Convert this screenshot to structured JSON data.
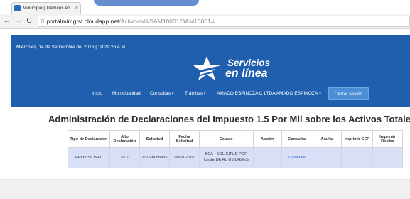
{
  "browser": {
    "tab_title": "Municipio | Trámites en L",
    "tab_close": "×",
    "url_host": "portalmimgtst.cloudapp.net",
    "url_path": "/ActivosMil/SAM10001/SAM10001#",
    "back": "←",
    "forward": "→",
    "reload": "C"
  },
  "header": {
    "datetime": "Miércoles, 14 de Septiembre del 2016 | 10:29:26 A.M.",
    "logo_line1": "Servicios",
    "logo_line2": "en línea",
    "nav": {
      "inicio": "Inicio",
      "municipalidad": "Municipalidad",
      "consultas": "Consultas",
      "tramites": "Trámites",
      "user": "AMADO ESPINOZA C LTDA AMADO ESPINOZA",
      "caret": "▾",
      "logout": "Cerrar sesión"
    }
  },
  "main": {
    "title": "Administración de Declaraciones del Impuesto 1.5 Por Mil sobre los Activos Totales",
    "columns": [
      "Tipo de Declaración",
      "Año Declaración",
      "Solicitud",
      "Fecha Solicitud",
      "Estado",
      "Acción",
      "Consultar",
      "Anular",
      "Imprimir CEP",
      "Imprimir Recibo"
    ],
    "rows": [
      {
        "tipo": "PROVISIONAL",
        "anio": "2011",
        "solicitud": "2016-0088955",
        "fecha": "09/08/2016",
        "estado": "SCA - SOLICITUD POR CESE DE ACTIVIDADES",
        "accion": "",
        "consultar": "Consultar",
        "anular": "",
        "cep": "",
        "recibo": ""
      }
    ]
  },
  "colors": {
    "header_blue": "#1f5fae",
    "button_blue": "#4d8fd6",
    "row_highlight": "#d9dff7",
    "link": "#2f6bbf"
  }
}
